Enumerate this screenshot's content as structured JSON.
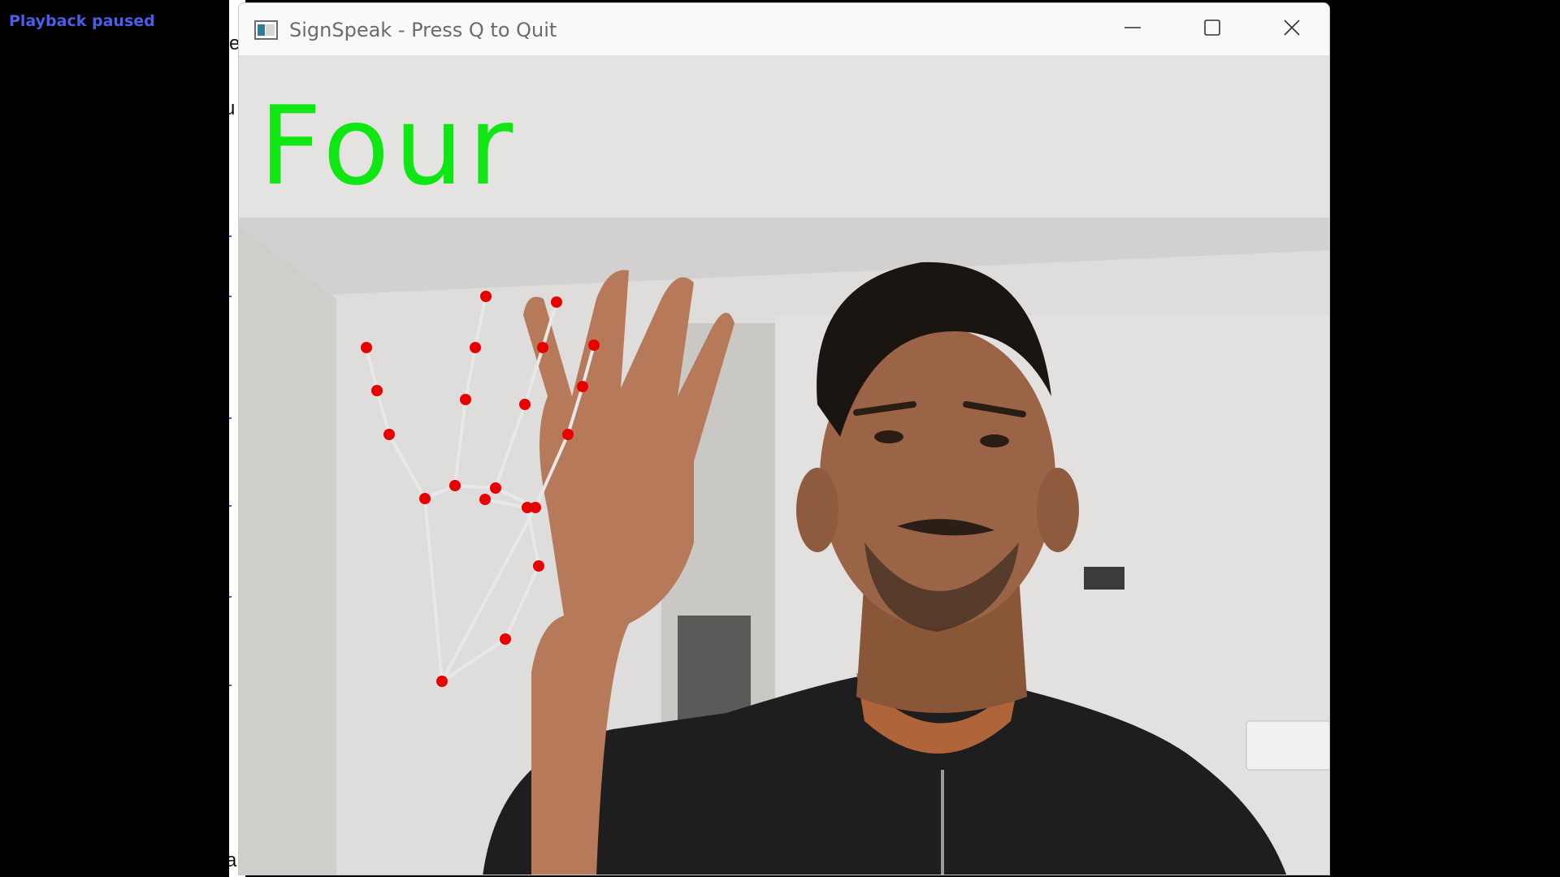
{
  "overlay": {
    "status": "Playback paused"
  },
  "background_window": {
    "fragments": [
      "e",
      "u",
      "a"
    ]
  },
  "window": {
    "title": "SignSpeak - Press Q to Quit",
    "icon": "app-window-icon",
    "controls": [
      "minimize-icon",
      "maximize-icon",
      "close-icon"
    ]
  },
  "camera": {
    "gesture_label": "Four",
    "label_color": "#10e614",
    "landmark_color": "#e80000",
    "skeleton_color": "#e8e8e8"
  }
}
